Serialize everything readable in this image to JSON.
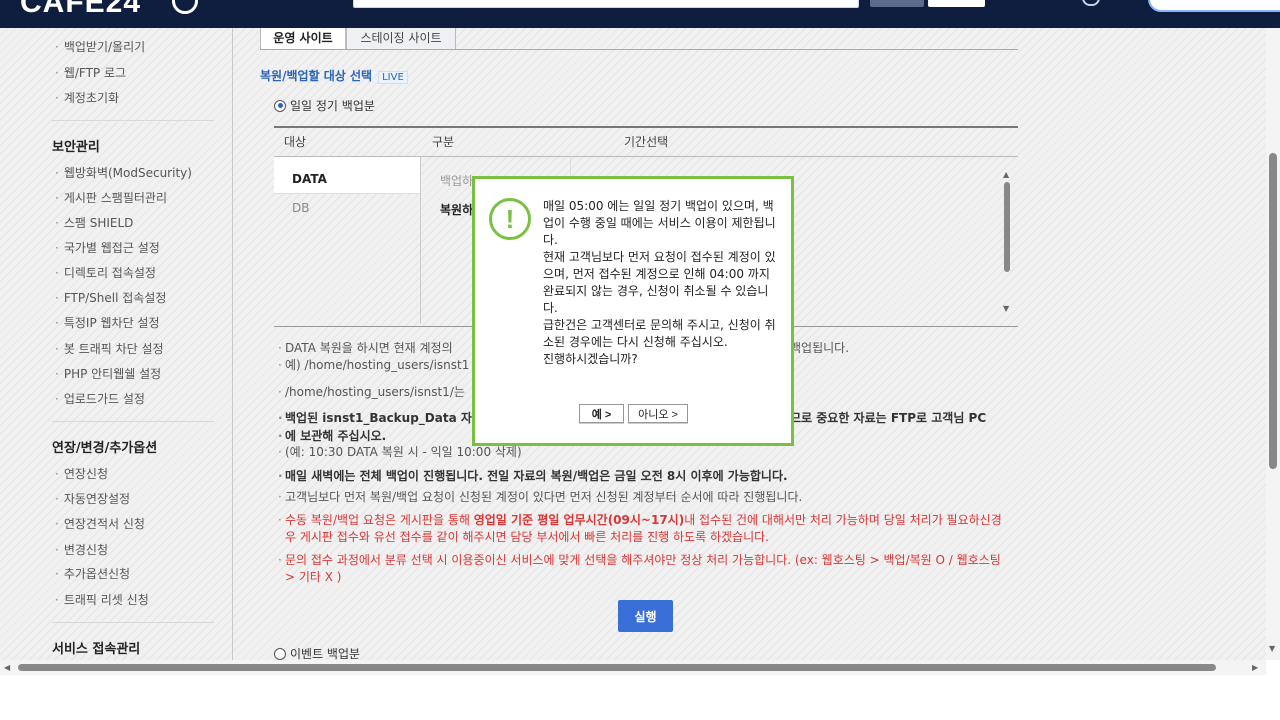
{
  "header": {
    "logo": "CAFE24"
  },
  "sidebar": {
    "items_top": [
      "백업받기/올리기",
      "웹/FTP 로그",
      "계정초기화"
    ],
    "security": {
      "title": "보안관리",
      "items": [
        "웹방화벽(ModSecurity)",
        "게시판 스팸필터관리",
        "스팸 SHIELD",
        "국가별 웹접근 설정",
        "디렉토리 접속설정",
        "FTP/Shell 접속설정",
        "특정IP 웹차단 설정",
        "봇 트래픽 차단 설정",
        "PHP 안티웹쉘 설정",
        "업로드가드 설정"
      ]
    },
    "options": {
      "title": "연장/변경/추가옵션",
      "items": [
        "연장신청",
        "자동연장설정",
        "연장견적서 신청",
        "변경신청",
        "추가옵션신청",
        "트래픽 리셋 신청"
      ]
    },
    "access": {
      "title": "서비스 접속관리"
    }
  },
  "tabs": [
    "운영 사이트",
    "스테이징 사이트"
  ],
  "section": {
    "title": "복원/백업할 대상 선택",
    "badge": "LIVE"
  },
  "radios": {
    "daily": "일일 정기 백업분",
    "event": "이벤트 백업분"
  },
  "table": {
    "headers": [
      "대상",
      "구분",
      "기간선택"
    ],
    "targets": [
      "DATA",
      "DB"
    ],
    "kinds": [
      "백업하",
      "복원하"
    ]
  },
  "notes": {
    "n1a": "DATA 복원을 하시면 현재 계정의",
    "n1b": "백업됩니다.",
    "n1c": "예) /home/hosting_users/isnst1",
    "n2": "/home/hosting_users/isnst1/는",
    "n3a": "백업된 isnst1_Backup_Data 자",
    "n3b": "므로 중요한 자료는 FTP로 고객님 PC",
    "n3c": "에 보관해 주십시오.",
    "n3d": "(예: 10:30 DATA 복원 시 - 익일 10:00 삭제)",
    "n4": "매일 새벽에는 전체 백업이 진행됩니다. 전일 자료의 복원/백업은 금일 오전 8시 이후에 가능합니다.",
    "n5": "고객님보다 먼저 복원/백업 요청이 신청된 계정이 있다면 먼저 신청된 계정부터 순서에 따라 진행됩니다.",
    "n6a": "수동 복원/백업 요청은 게시판을 통해 ",
    "n6b": "영업일 기준 평일 업무시간(09시~17시)",
    "n6c": "내 접수된 건에 대해서만 처리 가능하며 당일 처리가 필요하신경우 게시판 접수와 유선 접수를 같이 해주시면 담당 부서에서 빠른 처리를 진행 하도록 하겠습니다.",
    "n7": "문의 접수 과정에서 분류 선택 시 이용중이신 서비스에 맞게 선택을 해주셔야만 정상 처리 가능합니다. (ex: 웹호스팅 > 백업/복원 O / 웹호스팅 > 기타 X )"
  },
  "execute_label": "실행",
  "modal": {
    "message": "매일 05:00 에는 일일 정기 백업이 있으며, 백업이 수행 중일 때에는 서비스 이용이 제한됩니다.\n현재 고객님보다 먼저 요청이 접수된 계정이 있으며, 먼저 접수된 계정으로 인해 04:00 까지 완료되지 않는 경우, 신청이 취소될 수 있습니다.\n급한건은 고객센터로 문의해 주시고, 신청이 취소된 경우에는 다시 신청해 주십시오.\n진행하시겠습니까?",
    "yes": "예 >",
    "no": "아니오 >"
  }
}
